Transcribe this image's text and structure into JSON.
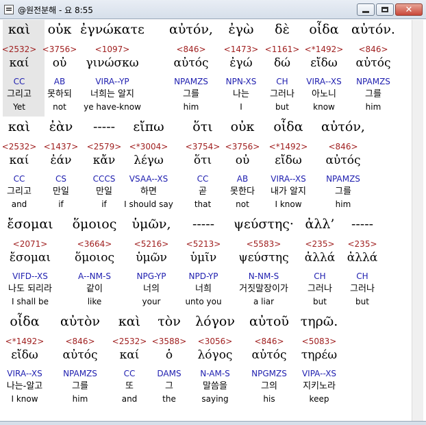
{
  "window": {
    "title": "@원전분해 - 요 8:55"
  },
  "groups": [
    {
      "words": [
        {
          "top": "καὶ",
          "num": "<2532>",
          "lemma": "καί",
          "parse": "CC",
          "kor": "그리고",
          "eng": "Yet"
        },
        {
          "top": "οὐκ",
          "num": "<3756>",
          "lemma": "οὐ",
          "parse": "AB",
          "kor": "못하되",
          "eng": "not"
        },
        {
          "top": "ἐγνώκατε",
          "num": "<1097>",
          "lemma": "γινώσκω",
          "parse": "VIRA--YP",
          "kor": "너희는 알지",
          "eng": "ye have-know"
        },
        {
          "top": "αὐτόν,",
          "num": "<846>",
          "lemma": "αὐτός",
          "parse": "NPAMZS",
          "kor": "그를",
          "eng": "him"
        },
        {
          "top": "ἐγὼ",
          "num": "<1473>",
          "lemma": "ἐγώ",
          "parse": "NPN-XS",
          "kor": "나는",
          "eng": "I"
        },
        {
          "top": "δὲ",
          "num": "<1161>",
          "lemma": "δώ",
          "parse": "CH",
          "kor": "그러나",
          "eng": "but"
        },
        {
          "top": "οἶδα",
          "num": "<*1492>",
          "lemma": "εἴδω",
          "parse": "VIRA--XS",
          "kor": "아노니",
          "eng": "know"
        },
        {
          "top": "αὐτόν.",
          "num": "<846>",
          "lemma": "αὐτός",
          "parse": "NPAMZS",
          "kor": "그를",
          "eng": "him"
        }
      ]
    },
    {
      "words": [
        {
          "top": "καὶ",
          "num": "<2532>",
          "lemma": "καί",
          "parse": "CC",
          "kor": "그리고",
          "eng": "and"
        },
        {
          "top": "ἐὰν",
          "num": "<1437>",
          "lemma": "ἐάν",
          "parse": "CS",
          "kor": "만일",
          "eng": "if"
        },
        {
          "top": "-----",
          "num": "<2579>",
          "lemma": "κἄν",
          "parse": "CCCS",
          "kor": "만일",
          "eng": "if"
        },
        {
          "top": "εἴπω",
          "num": "<*3004>",
          "lemma": "λέγω",
          "parse": "VSAA--XS",
          "kor": "하면",
          "eng": "I should say"
        },
        {
          "top": "ὅτι",
          "num": "<3754>",
          "lemma": "ὅτι",
          "parse": "CC",
          "kor": "곧",
          "eng": "that"
        },
        {
          "top": "οὐκ",
          "num": "<3756>",
          "lemma": "οὐ",
          "parse": "AB",
          "kor": "못한다",
          "eng": "not"
        },
        {
          "top": "οἶδα",
          "num": "<*1492>",
          "lemma": "εἴδω",
          "parse": "VIRA--XS",
          "kor": "내가 알지",
          "eng": "I know"
        },
        {
          "top": "αὐτόν,",
          "num": "<846>",
          "lemma": "αὐτός",
          "parse": "NPAMZS",
          "kor": "그를",
          "eng": "him"
        }
      ]
    },
    {
      "words": [
        {
          "top": "ἔσομαι",
          "num": "<2071>",
          "lemma": "ἔσομαι",
          "parse": "VIFD--XS",
          "kor": "나도 되리라",
          "eng": "I shall be"
        },
        {
          "top": "ὅμοιος",
          "num": "<3664>",
          "lemma": "ὅμοιος",
          "parse": "A--NM-S",
          "kor": "같이",
          "eng": "like"
        },
        {
          "top": "ὑμῶν,",
          "num": "<5216>",
          "lemma": "ὑμῶν",
          "parse": "NPG-YP",
          "kor": "너의",
          "eng": "your"
        },
        {
          "top": "-----",
          "num": "<5213>",
          "lemma": "ὑμῖν",
          "parse": "NPD-YP",
          "kor": "너희",
          "eng": "unto you"
        },
        {
          "top": "ψεύστης·",
          "num": "<5583>",
          "lemma": "ψεύστης",
          "parse": "N-NM-S",
          "kor": "거짓말장이가",
          "eng": "a liar"
        },
        {
          "top": "ἀλλ’",
          "num": "<235>",
          "lemma": "ἀλλά",
          "parse": "CH",
          "kor": "그러나",
          "eng": "but"
        },
        {
          "top": "-----",
          "num": "<235>",
          "lemma": "ἀλλά",
          "parse": "CH",
          "kor": "그러나",
          "eng": "but"
        }
      ]
    },
    {
      "words": [
        {
          "top": "οἶδα",
          "num": "<*1492>",
          "lemma": "εἴδω",
          "parse": "VIRA--XS",
          "kor": "나는-알고",
          "eng": "I know"
        },
        {
          "top": "αὐτὸν",
          "num": "<846>",
          "lemma": "αὐτός",
          "parse": "NPAMZS",
          "kor": "그를",
          "eng": "him"
        },
        {
          "top": "καὶ",
          "num": "<2532>",
          "lemma": "καί",
          "parse": "CC",
          "kor": "또",
          "eng": "and"
        },
        {
          "top": "τὸν",
          "num": "<3588>",
          "lemma": "ὁ",
          "parse": "DAMS",
          "kor": "그",
          "eng": "the"
        },
        {
          "top": "λόγον",
          "num": "<3056>",
          "lemma": "λόγος",
          "parse": "N-AM-S",
          "kor": "말씀을",
          "eng": "saying"
        },
        {
          "top": "αὐτοῦ",
          "num": "<846>",
          "lemma": "αὐτός",
          "parse": "NPGMZS",
          "kor": "그의",
          "eng": "his"
        },
        {
          "top": "τηρῶ.",
          "num": "<5083>",
          "lemma": "τηρέω",
          "parse": "VIPA--XS",
          "kor": "지키노라",
          "eng": "keep"
        }
      ]
    }
  ]
}
